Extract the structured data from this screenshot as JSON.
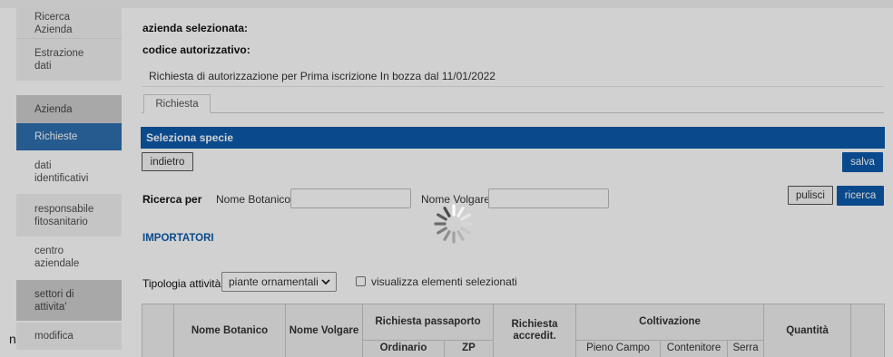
{
  "sidebar": {
    "items": [
      {
        "label": "Ricerca\nAzienda"
      },
      {
        "label": "Estrazione\ndati"
      },
      {
        "label": "Azienda"
      },
      {
        "label": "Richieste"
      },
      {
        "label": "dati\nidentificativi"
      },
      {
        "label": "responsabile\nfitosanitario"
      },
      {
        "label": "centro\naziendale"
      },
      {
        "label": "settori di\nattivita'"
      },
      {
        "label": "modifica"
      }
    ],
    "stub_char": "n"
  },
  "header": {
    "azienda_label": "azienda selezionata:",
    "codice_label": "codice autorizzativo:",
    "request_line": "Richiesta di autorizzazione per Prima iscrizione In bozza dal 11/01/2022"
  },
  "tabs": [
    {
      "label": "Richiesta"
    }
  ],
  "section": {
    "title": "Seleziona specie",
    "back_label": "indietro",
    "save_label": "salva"
  },
  "search": {
    "ricerca_per_label": "Ricerca per",
    "nome_botanico_label": "Nome Botanico",
    "nome_botanico_value": "",
    "nome_volgare_label": "Nome Volgare",
    "nome_volgare_value": "",
    "clear_label": "pulisci",
    "search_label": "ricerca"
  },
  "importatori_label": "IMPORTATORI",
  "filter": {
    "tipologia_label": "Tipologia attività",
    "tipologia_value": "piante ornamentali",
    "show_selected_label": "visualizza elementi selezionati"
  },
  "table": {
    "headers": {
      "nome_botanico": "Nome Botanico",
      "nome_volgare": "Nome Volgare",
      "richiesta_passaporto": "Richiesta passaporto",
      "ordinario": "Ordinario",
      "zp": "ZP",
      "richiesta_accredit": "Richiesta accredit.",
      "coltivazione": "Coltivazione",
      "pieno_campo": "Pieno Campo",
      "contenitore": "Contenitore",
      "serra": "Serra",
      "quantita": "Quantità"
    }
  },
  "colors": {
    "primary_blue": "#0d5bab",
    "sidebar_active": "#2f6fb0"
  },
  "icons": {
    "loading": "loading-spinner-icon",
    "dropdown": "chevron-down-icon"
  }
}
